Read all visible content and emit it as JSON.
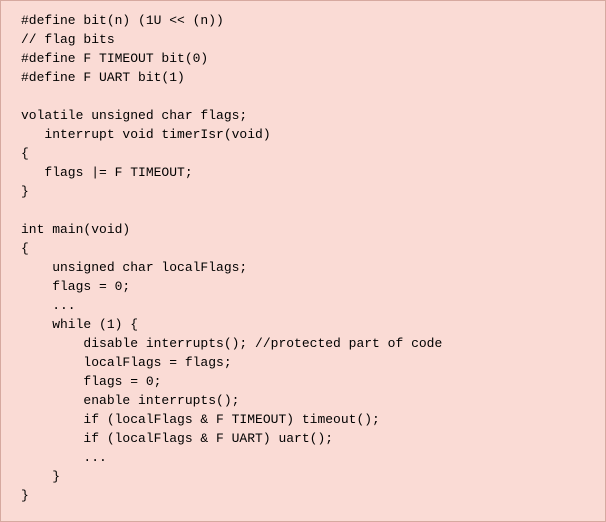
{
  "code": {
    "lines": [
      "#define bit(n) (1U << (n))",
      "// flag bits",
      "#define F TIMEOUT bit(0)",
      "#define F UART bit(1)",
      "",
      "volatile unsigned char flags;",
      "   interrupt void timerIsr(void)",
      "{",
      "   flags |= F TIMEOUT;",
      "}",
      "",
      "int main(void)",
      "{",
      "    unsigned char localFlags;",
      "    flags = 0;",
      "    ...",
      "    while (1) {",
      "        disable interrupts(); //protected part of code",
      "        localFlags = flags;",
      "        flags = 0;",
      "        enable interrupts();",
      "        if (localFlags & F TIMEOUT) timeout();",
      "        if (localFlags & F UART) uart();",
      "        ...",
      "    }",
      "}"
    ]
  }
}
